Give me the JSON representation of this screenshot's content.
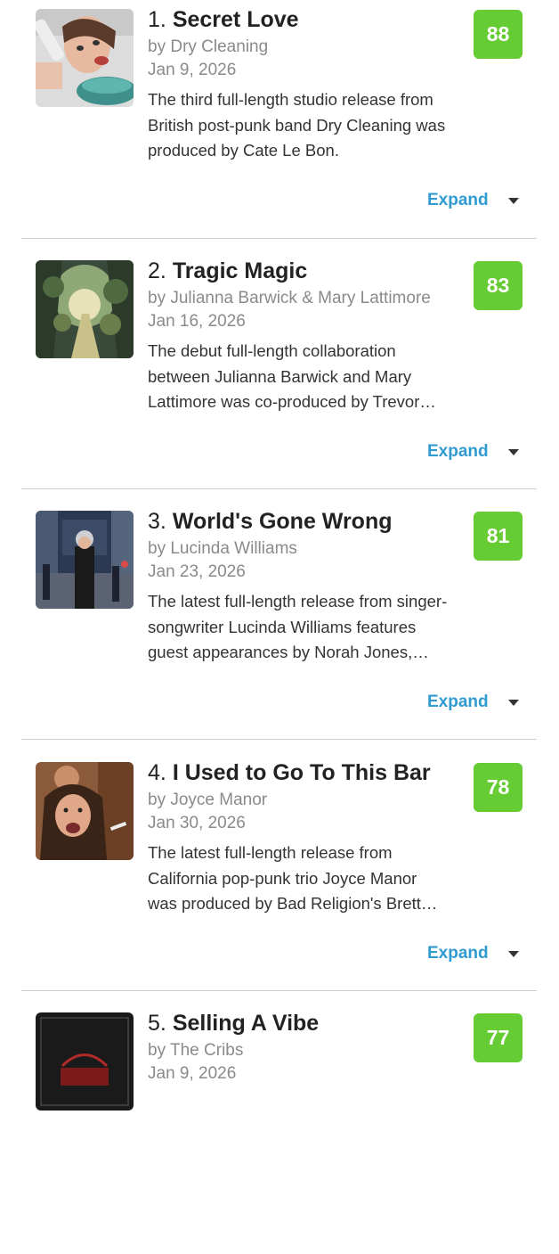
{
  "expand_label": "Expand",
  "albums": [
    {
      "rank": "1.",
      "title": "Secret Love",
      "artist": "by Dry Cleaning",
      "date": "Jan 9, 2026",
      "description_lines": [
        "The third full-length studio release from",
        "British post-punk band Dry Cleaning was",
        "produced by Cate Le Bon."
      ],
      "score": "88"
    },
    {
      "rank": "2.",
      "title": "Tragic Magic",
      "artist": "by Julianna Barwick & Mary Lattimore",
      "date": "Jan 16, 2026",
      "description_lines": [
        "The debut full-length collaboration",
        "between Julianna Barwick and Mary",
        "Lattimore was co-produced by Trevor…"
      ],
      "score": "83"
    },
    {
      "rank": "3.",
      "title": "World's Gone Wrong",
      "artist": "by Lucinda Williams",
      "date": "Jan 23, 2026",
      "description_lines": [
        "The latest full-length release from singer-",
        "songwriter Lucinda Williams features",
        "guest appearances by Norah Jones,…"
      ],
      "score": "81"
    },
    {
      "rank": "4.",
      "title": "I Used to Go To This Bar",
      "artist": "by Joyce Manor",
      "date": "Jan 30, 2026",
      "description_lines": [
        "The latest full-length release from",
        "California pop-punk trio Joyce Manor",
        "was produced by Bad Religion's Brett…"
      ],
      "score": "78"
    },
    {
      "rank": "5.",
      "title": "Selling A Vibe",
      "artist": "by The Cribs",
      "date": "Jan 9, 2026",
      "description_lines": [],
      "score": "77"
    }
  ],
  "colors": {
    "score_green": "#66cc33",
    "expand_blue": "#2f9bd1"
  }
}
